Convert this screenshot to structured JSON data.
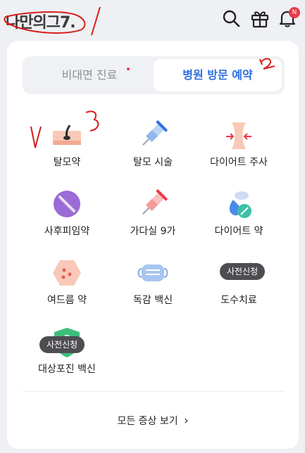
{
  "header": {
    "logo_text": "나만의",
    "logo_suffix": "그7.",
    "notification_badge": "N",
    "icons": [
      "search-icon",
      "gift-icon",
      "bell-icon"
    ]
  },
  "tabs": [
    {
      "label": "비대면 진료",
      "selected": false
    },
    {
      "label": "병원 방문 예약",
      "selected": true
    }
  ],
  "categories": [
    {
      "label": "탈모약",
      "icon": "hair-loss-pill-icon"
    },
    {
      "label": "탈모 시술",
      "icon": "syringe-icon"
    },
    {
      "label": "다이어트 주사",
      "icon": "waist-icon"
    },
    {
      "label": "사후피임약",
      "icon": "pill-icon"
    },
    {
      "label": "가다실 9가",
      "icon": "vaccine-syringe-icon"
    },
    {
      "label": "다이어트 약",
      "icon": "diet-pills-icon"
    },
    {
      "label": "여드름 약",
      "icon": "acne-icon"
    },
    {
      "label": "독감 백신",
      "icon": "mask-icon"
    },
    {
      "label": "도수치료",
      "icon": "body-icon",
      "badge": "사전신청"
    },
    {
      "label": "대상포진 백신",
      "icon": "shield-icon",
      "badge": "사전신청"
    }
  ],
  "footer": {
    "more_label": "모든 증상 보기",
    "chevron": "›"
  },
  "annotations": [
    "1",
    "2",
    "3"
  ],
  "colors": {
    "accent": "#2b6fe0",
    "badge_bg": "#4d4d52",
    "notification": "#e9384b"
  }
}
